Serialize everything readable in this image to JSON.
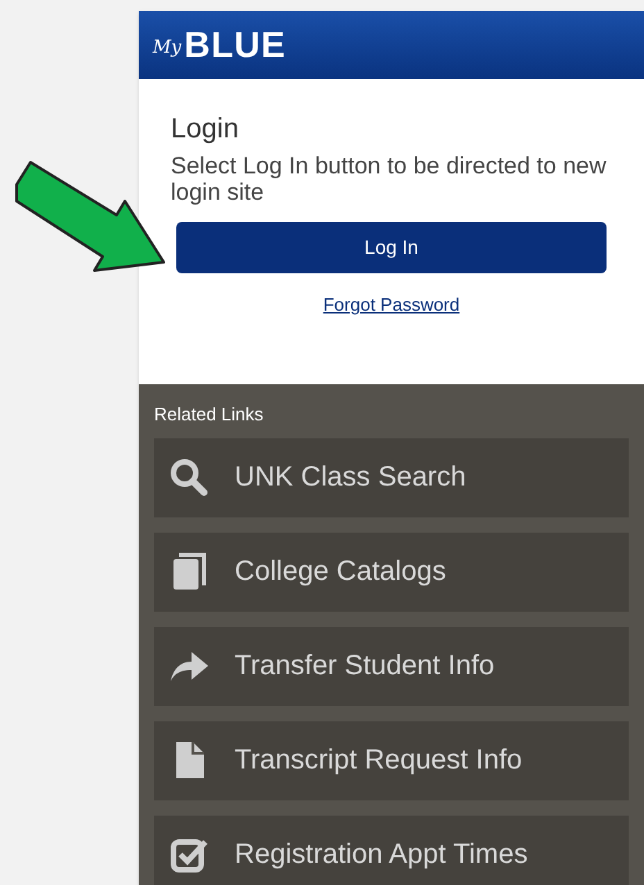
{
  "header": {
    "logo_prefix": "My",
    "logo": "BLUE"
  },
  "login": {
    "title": "Login",
    "message": "Select Log In button to be directed to new login site",
    "button": "Log In",
    "link": "Forgot Password"
  },
  "related_links": {
    "title": "Related Links",
    "items": [
      {
        "label": "UNK Class Search"
      },
      {
        "label": "College Catalogs"
      },
      {
        "label": "Transfer Student Info"
      },
      {
        "label": "Transcript Request Info"
      },
      {
        "label": "Registration Appt Times"
      }
    ]
  }
}
